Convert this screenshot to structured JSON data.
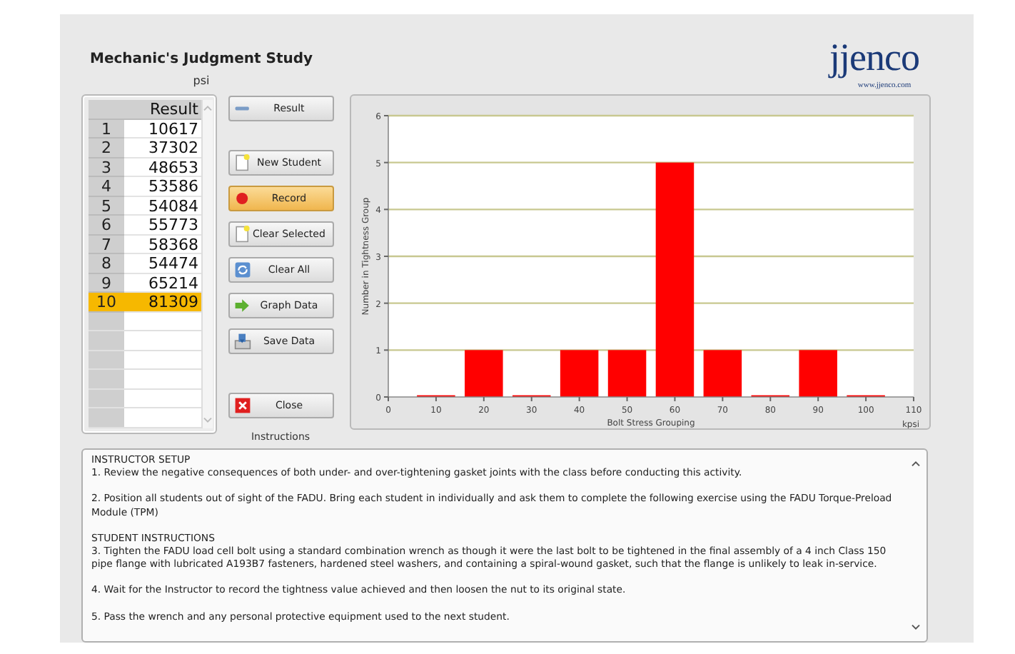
{
  "title": "Mechanic's Judgment Study",
  "logo": {
    "name": "jjenco",
    "url": "www.jjenco.com"
  },
  "results": {
    "unit": "psi",
    "column": "Result",
    "rows": [
      {
        "index": "1",
        "value": "10617",
        "selected": false
      },
      {
        "index": "2",
        "value": "37302",
        "selected": false
      },
      {
        "index": "3",
        "value": "48653",
        "selected": false
      },
      {
        "index": "4",
        "value": "53586",
        "selected": false
      },
      {
        "index": "5",
        "value": "54084",
        "selected": false
      },
      {
        "index": "6",
        "value": "55773",
        "selected": false
      },
      {
        "index": "7",
        "value": "58368",
        "selected": false
      },
      {
        "index": "8",
        "value": "54474",
        "selected": false
      },
      {
        "index": "9",
        "value": "65214",
        "selected": false
      },
      {
        "index": "10",
        "value": "81309",
        "selected": true
      }
    ]
  },
  "result_button": {
    "label": "Result",
    "highlighted": false
  },
  "buttons": [
    {
      "label": "New Student",
      "highlighted": false
    },
    {
      "label": "Record",
      "highlighted": true
    },
    {
      "label": "Clear Selected",
      "highlighted": false
    },
    {
      "label": "Clear All",
      "highlighted": false
    },
    {
      "label": "Graph Data",
      "highlighted": false
    },
    {
      "label": "Save Data",
      "highlighted": false
    }
  ],
  "close_button": {
    "label": "Close",
    "highlighted": false
  },
  "instructions_tab": "Instructions",
  "chart": {
    "chart_data": {
      "type": "bar",
      "xlabel": "Bolt Stress Grouping",
      "ylabel": "Number in Tightness Group",
      "x": [
        10,
        20,
        30,
        40,
        50,
        60,
        70,
        80,
        90,
        100
      ],
      "series": [
        {
          "color": "#ff0000",
          "values": [
            0,
            1,
            0,
            1,
            1,
            5,
            1,
            0,
            1,
            0
          ]
        }
      ],
      "xlim": [
        0,
        110
      ],
      "ylim": [
        0,
        6
      ],
      "xticks": [
        {
          "value": 0,
          "label": "0"
        },
        {
          "value": 10,
          "label": "10"
        },
        {
          "value": 20,
          "label": "20"
        },
        {
          "value": 30,
          "label": "30"
        },
        {
          "value": 40,
          "label": "40"
        },
        {
          "value": 50,
          "label": "50"
        },
        {
          "value": 60,
          "label": "60"
        },
        {
          "value": 70,
          "label": "70"
        },
        {
          "value": 80,
          "label": "80"
        },
        {
          "value": 90,
          "label": "90"
        },
        {
          "value": 100,
          "label": "100"
        },
        {
          "value": 110,
          "label": "110"
        }
      ],
      "yticks": [
        {
          "value": 0,
          "label": "0"
        },
        {
          "value": 1,
          "label": "1"
        },
        {
          "value": 2,
          "label": "2"
        },
        {
          "value": 3,
          "label": "3"
        },
        {
          "value": 4,
          "label": "4"
        },
        {
          "value": 5,
          "label": "5"
        },
        {
          "value": 6,
          "label": "6"
        }
      ],
      "grid": true
    },
    "unit": "kpsi"
  },
  "instructions": [
    {
      "kind": "heading",
      "text": "INSTRUCTOR SETUP"
    },
    {
      "kind": "item",
      "text": "1.  Review the negative consequences of both under- and over-tightening gasket joints with the class before conducting this activity."
    },
    {
      "kind": "item",
      "text": "2.  Position all students out of sight of the FADU. Bring each student in individually and ask them to complete the following exercise using the FADU Torque-Preload Module (TPM)"
    },
    {
      "kind": "heading",
      "text": "STUDENT INSTRUCTIONS"
    },
    {
      "kind": "item",
      "text": "3.  Tighten the FADU load cell bolt using a standard combination wrench as though it were the last bolt to be tightened in the final assembly of a 4 inch Class 150 pipe flange with lubricated A193B7 fasteners, hardened steel washers, and containing a spiral-wound gasket, such that the flange is unlikely to leak in-service."
    },
    {
      "kind": "item",
      "text": "4.  Wait for the Instructor to record the tightness value achieved and then loosen the nut to its original state."
    },
    {
      "kind": "item",
      "text": "5.  Pass the wrench and any personal protective equipment used to the next student."
    }
  ]
}
